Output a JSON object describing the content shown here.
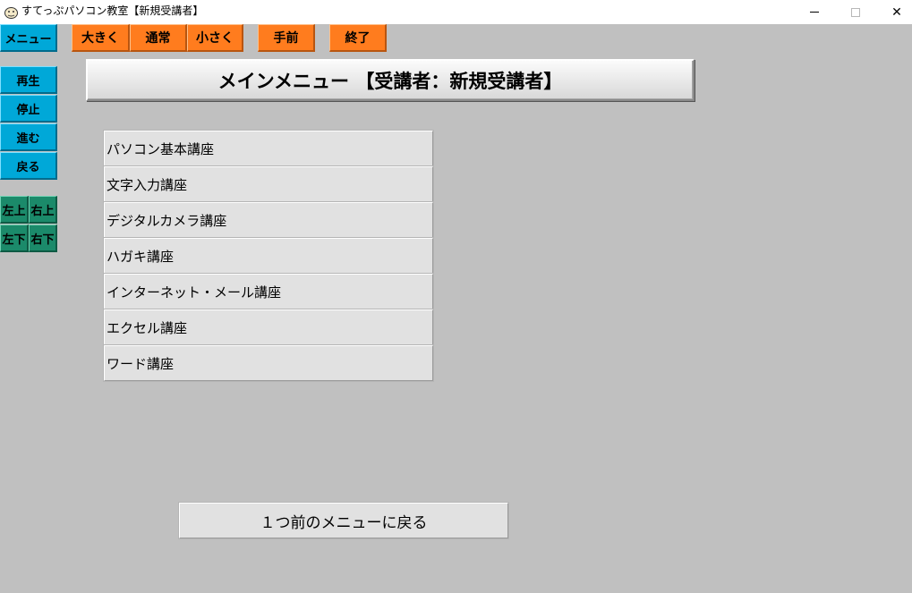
{
  "window": {
    "title": "すてっぷパソコン教室【新規受講者】",
    "close_glyph": "✕"
  },
  "toolbar": {
    "menu_label": "メニュー",
    "larger_label": "大きく",
    "normal_label": "通常",
    "smaller_label": "小さく",
    "front_label": "手前",
    "exit_label": "終了"
  },
  "side": {
    "play_label": "再生",
    "stop_label": "停止",
    "forward_label": "進む",
    "back_label": "戻る",
    "top_left_label": "左上",
    "top_right_label": "右上",
    "bottom_left_label": "左下",
    "bottom_right_label": "右下"
  },
  "header": {
    "title": "メインメニュー 【受講者：新規受講者】"
  },
  "courses": [
    {
      "label": "パソコン基本講座"
    },
    {
      "label": "文字入力講座"
    },
    {
      "label": "デジタルカメラ講座"
    },
    {
      "label": "ハガキ講座"
    },
    {
      "label": "インターネット・メール講座"
    },
    {
      "label": "エクセル講座"
    },
    {
      "label": "ワード講座"
    }
  ],
  "footer": {
    "back_menu_label": "１つ前のメニューに戻る"
  },
  "colors": {
    "background": "#c0c0c0",
    "cyan_button": "#00a8d8",
    "orange_button": "#ff7c1e",
    "teal_button": "#1b8a6a"
  }
}
